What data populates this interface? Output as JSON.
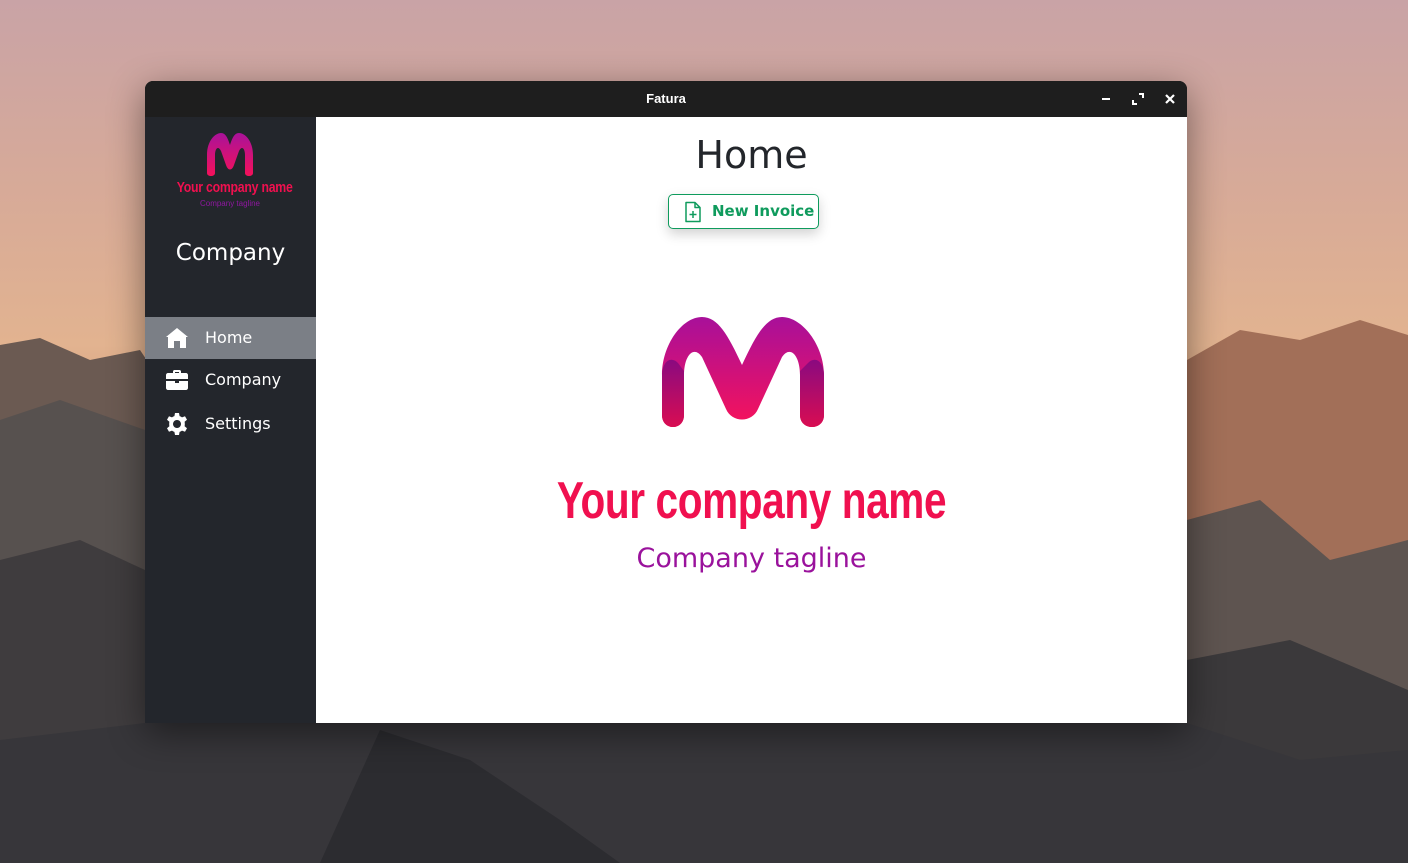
{
  "window": {
    "title": "Fatura"
  },
  "titlebar": {
    "buttons": [
      {
        "name": "minimize",
        "icon": "minimize-icon"
      },
      {
        "name": "maximize",
        "icon": "maximize-icon"
      },
      {
        "name": "close",
        "icon": "close-icon"
      }
    ]
  },
  "sidebar": {
    "logo": {
      "icon": "company-logo-icon",
      "name_text": "Your company name",
      "tagline_text": "Company tagline"
    },
    "heading": "Company",
    "items": [
      {
        "label": "Home",
        "icon": "home-icon",
        "active": true
      },
      {
        "label": "Company",
        "icon": "briefcase-icon",
        "active": false
      },
      {
        "label": "Settings",
        "icon": "gear-icon",
        "active": false
      }
    ]
  },
  "main": {
    "title": "Home",
    "new_invoice_button": {
      "label": "New Invoice",
      "icon": "file-plus-icon"
    },
    "logo": {
      "icon": "company-logo-icon"
    },
    "company_name": "Your company name",
    "company_tagline": "Company tagline"
  },
  "colors": {
    "sidebar_bg": "#23262c",
    "active_item_bg": "#7b7f86",
    "accent_green": "#0f9b5d",
    "brand_pink": "#f0104f",
    "brand_purple": "#9a129c"
  }
}
